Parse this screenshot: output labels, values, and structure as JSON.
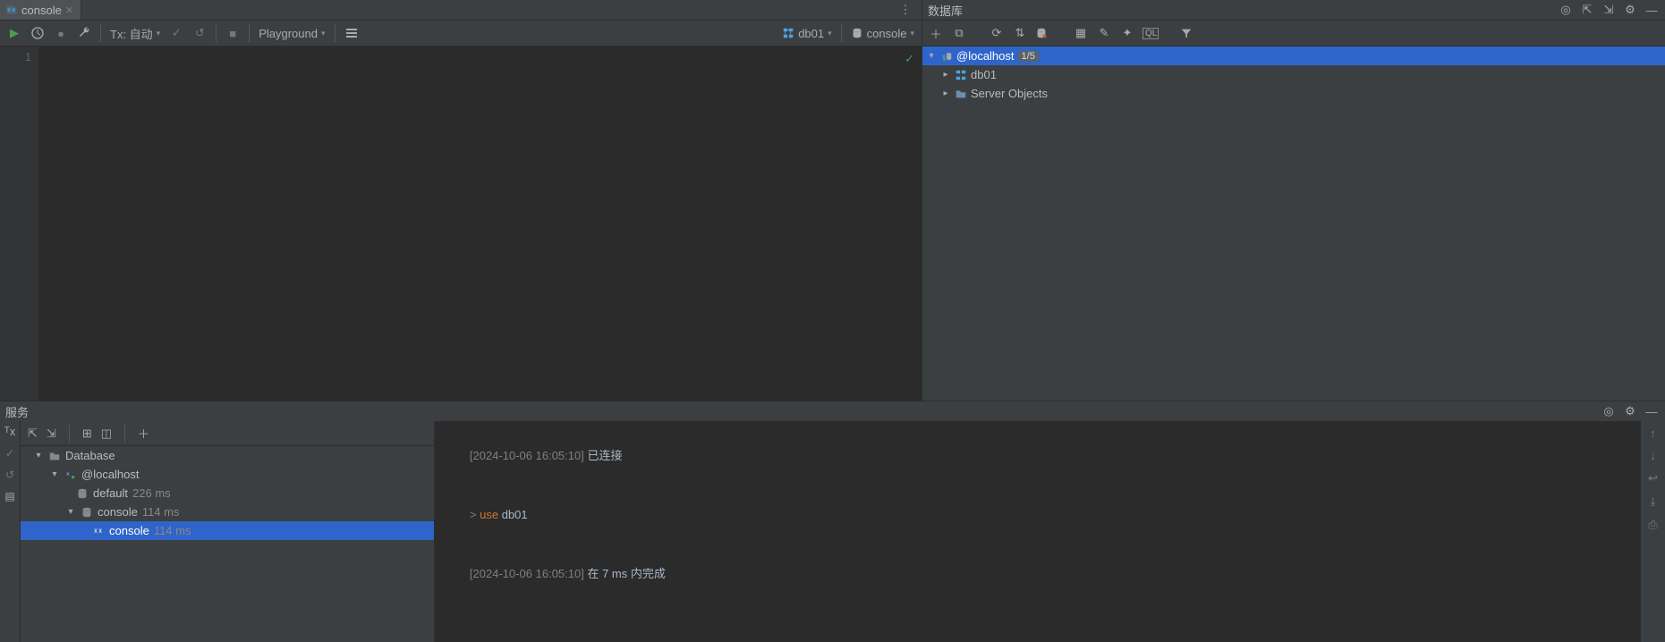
{
  "editor": {
    "tab": {
      "label": "console"
    },
    "toolbar": {
      "tx_label": "Tx: 自动",
      "playground_label": "Playground",
      "schema_label": "db01",
      "console_label": "console"
    },
    "line_number": "1",
    "code": ""
  },
  "database_panel": {
    "title": "数据库",
    "root": {
      "label": "@localhost",
      "badge": "1/5"
    },
    "children": [
      {
        "label": "db01"
      },
      {
        "label": "Server Objects"
      }
    ]
  },
  "services_panel": {
    "title": "服务",
    "tree": {
      "root": "Database",
      "host": "@localhost",
      "items": [
        {
          "label": "default",
          "time": "226 ms"
        },
        {
          "label": "console",
          "time": "114 ms",
          "children": [
            {
              "label": "console",
              "time": "114 ms"
            }
          ]
        }
      ]
    },
    "output": {
      "line1_ts": "[2024-10-06 16:05:10]",
      "line1_txt": "已连接",
      "line2_prompt": ">",
      "line2_kw": "use",
      "line2_ident": "db01",
      "line3_ts": "[2024-10-06 16:05:10]",
      "line3_txt": "在 7 ms 内完成"
    }
  }
}
